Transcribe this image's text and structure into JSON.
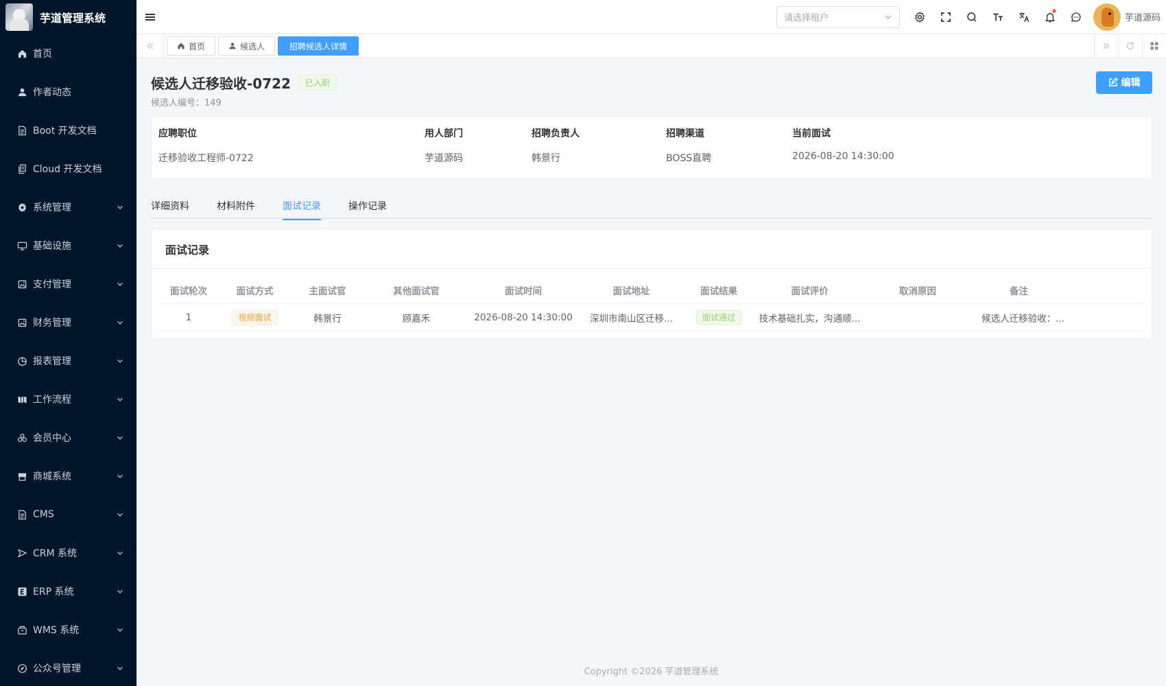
{
  "app": {
    "title": "芋道管理系统"
  },
  "sidebar": {
    "items": [
      {
        "label": "首页",
        "icon": "home-icon",
        "expandable": false
      },
      {
        "label": "作者动态",
        "icon": "user-icon",
        "expandable": false
      },
      {
        "label": "Boot 开发文档",
        "icon": "document-icon",
        "expandable": false
      },
      {
        "label": "Cloud 开发文档",
        "icon": "document-copy-icon",
        "expandable": false
      },
      {
        "label": "系统管理",
        "icon": "gear-icon",
        "expandable": true
      },
      {
        "label": "基础设施",
        "icon": "monitor-icon",
        "expandable": true
      },
      {
        "label": "支付管理",
        "icon": "picture-icon",
        "expandable": true
      },
      {
        "label": "财务管理",
        "icon": "picture-icon",
        "expandable": true
      },
      {
        "label": "报表管理",
        "icon": "pie-chart-icon",
        "expandable": true
      },
      {
        "label": "工作流程",
        "icon": "flow-icon",
        "expandable": true
      },
      {
        "label": "会员中心",
        "icon": "members-icon",
        "expandable": true
      },
      {
        "label": "商城系统",
        "icon": "shop-icon",
        "expandable": true
      },
      {
        "label": "CMS",
        "icon": "document-icon",
        "expandable": true
      },
      {
        "label": "CRM 系统",
        "icon": "crm-icon",
        "expandable": true
      },
      {
        "label": "ERP 系统",
        "icon": "erp-icon",
        "expandable": true
      },
      {
        "label": "WMS 系统",
        "icon": "box-icon",
        "expandable": true
      },
      {
        "label": "公众号管理",
        "icon": "compass-icon",
        "expandable": true
      }
    ]
  },
  "header": {
    "tenant_placeholder": "请选择租户",
    "username": "芋道源码"
  },
  "tags": {
    "items": [
      {
        "label": "首页",
        "icon": "home-icon",
        "active": false
      },
      {
        "label": "候选人",
        "icon": "user-icon",
        "active": false
      },
      {
        "label": "招聘候选人详情",
        "icon": "",
        "active": true
      }
    ]
  },
  "candidate": {
    "name": "候选人迁移验收-0722",
    "status": "已入职",
    "number_label": "候选人编号：",
    "number": "149",
    "edit_label": "编辑"
  },
  "info": [
    {
      "label": "应聘职位",
      "value": "迁移验收工程师-0722"
    },
    {
      "label": "用人部门",
      "value": "芋道源码"
    },
    {
      "label": "招聘负责人",
      "value": "韩景行"
    },
    {
      "label": "招聘渠道",
      "value": "BOSS直聘"
    },
    {
      "label": "当前面试",
      "value": "2026-08-20 14:30:00"
    }
  ],
  "tabs": [
    {
      "label": "详细资料",
      "active": false
    },
    {
      "label": "材料附件",
      "active": false
    },
    {
      "label": "面试记录",
      "active": true
    },
    {
      "label": "操作记录",
      "active": false
    }
  ],
  "records": {
    "title": "面试记录",
    "columns": [
      "面试轮次",
      "面试方式",
      "主面试官",
      "其他面试官",
      "面试时间",
      "面试地址",
      "面试结果",
      "面试评价",
      "取消原因",
      "备注"
    ],
    "rows": [
      {
        "round": "1",
        "method": "视频面试",
        "interviewer": "韩景行",
        "others": "顾嘉禾",
        "time": "2026-08-20 14:30:00",
        "address": "深圳市南山区迁移...",
        "result": "面试通过",
        "evaluation": "技术基础扎实，沟通顺...",
        "cancel_reason": "",
        "remark": "候选人迁移验收：..."
      }
    ]
  },
  "footer": {
    "copyright": "Copyright ©2026 芋道管理系统"
  },
  "colors": {
    "primary": "#409eff",
    "sidebar_bg": "#001529",
    "success": "#95d475",
    "warning": "#e6a23c"
  }
}
